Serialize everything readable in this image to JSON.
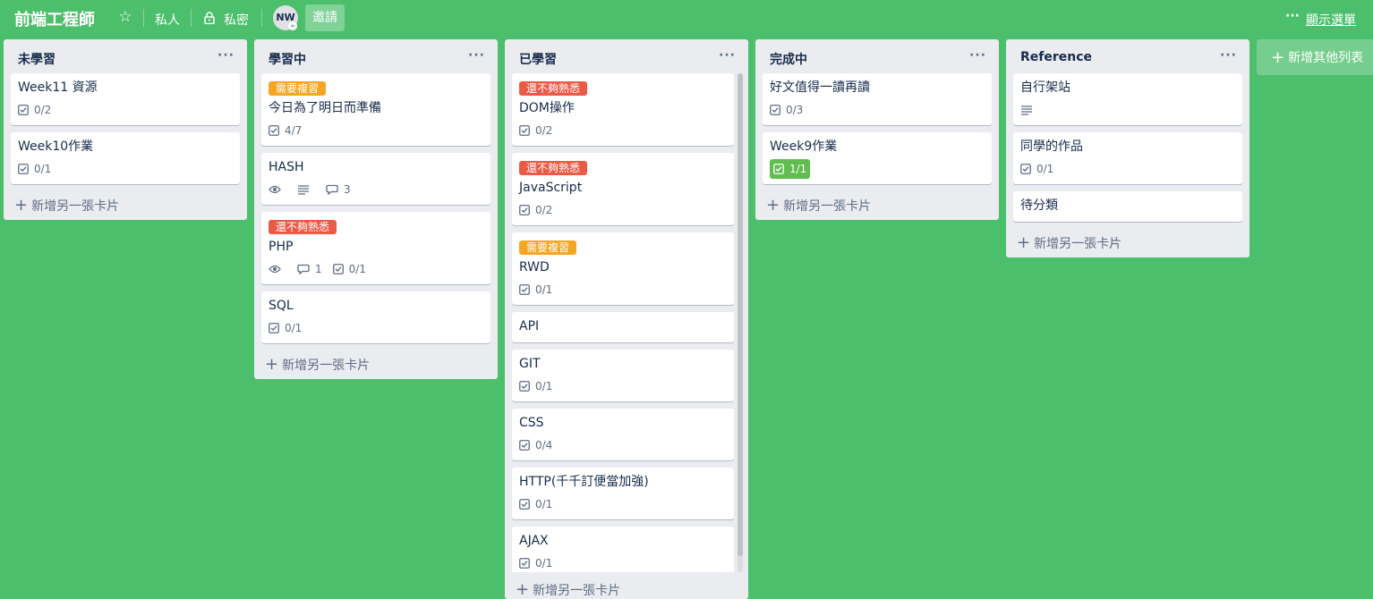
{
  "header": {
    "board_title": "前端工程師",
    "visibility_team": "私人",
    "visibility_private": "私密",
    "avatar_initials": "NW",
    "invite_label": "邀請",
    "menu_dots": "···",
    "show_menu_label": "顯示選單"
  },
  "add_card_label": "新增另一張卡片",
  "add_list_label": "新增其他列表",
  "list_menu_dots": "···",
  "colors": {
    "background": "#4bbf6b",
    "label_orange": "#f6a623",
    "label_red": "#eb5a46",
    "badge_done": "#61bd4f"
  },
  "lists": [
    {
      "title": "未學習",
      "cards": [
        {
          "title": "Week11 資源",
          "checklist": "0/2"
        },
        {
          "title": "Week10作業",
          "checklist": "0/1"
        }
      ]
    },
    {
      "title": "學習中",
      "cards": [
        {
          "label": "需要複習",
          "label_color": "orange",
          "title": "今日為了明日而準備",
          "checklist": "4/7"
        },
        {
          "title": "HASH",
          "comments": "3"
        },
        {
          "label": "還不夠熟悉",
          "label_color": "red",
          "title": "PHP",
          "comments": "1",
          "checklist": "0/1"
        },
        {
          "title": "SQL",
          "checklist": "0/1"
        }
      ]
    },
    {
      "title": "已學習",
      "cards": [
        {
          "label": "還不夠熟悉",
          "label_color": "red",
          "title": "DOM操作",
          "checklist": "0/2"
        },
        {
          "label": "還不夠熟悉",
          "label_color": "red",
          "title": "JavaScript",
          "checklist": "0/2"
        },
        {
          "label": "需要複習",
          "label_color": "orange",
          "title": "RWD",
          "checklist": "0/1"
        },
        {
          "title": "API"
        },
        {
          "title": "GIT",
          "checklist": "0/1"
        },
        {
          "title": "CSS",
          "checklist": "0/4"
        },
        {
          "title": "HTTP(千千訂便當加強)",
          "checklist": "0/1"
        },
        {
          "title": "AJAX",
          "checklist": "0/1"
        }
      ]
    },
    {
      "title": "完成中",
      "cards": [
        {
          "title": "好文值得一讀再讀",
          "checklist": "0/3"
        },
        {
          "title": "Week9作業",
          "checklist": "1/1"
        }
      ]
    },
    {
      "title": "Reference",
      "cards": [
        {
          "title": "自行架站"
        },
        {
          "title": "同學的作品",
          "checklist": "0/1"
        },
        {
          "title": "待分類"
        }
      ]
    }
  ]
}
